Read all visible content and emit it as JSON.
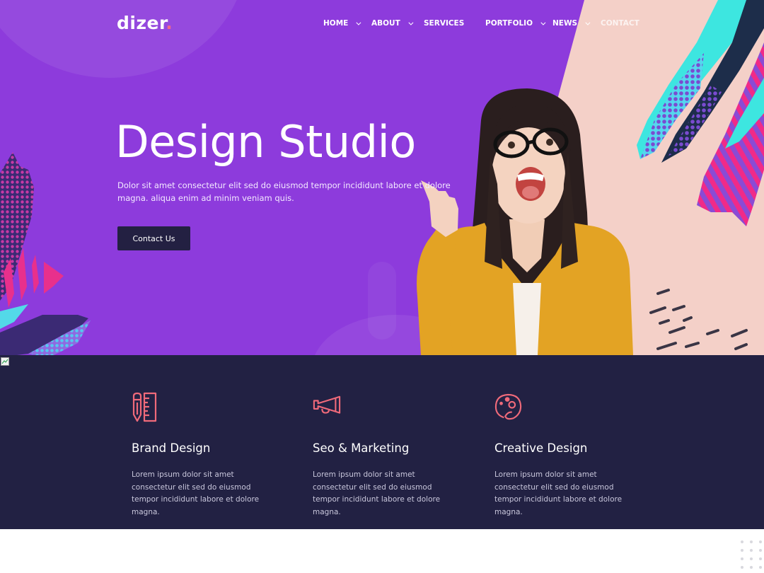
{
  "brand": {
    "name": "dizer",
    "dot": ".",
    "accent_color": "#f06a8a"
  },
  "nav": {
    "items": [
      {
        "label": "HOME",
        "has_dropdown": true
      },
      {
        "label": "ABOUT",
        "has_dropdown": true
      },
      {
        "label": "SERVICES",
        "has_dropdown": false
      },
      {
        "label": "PORTFOLIO",
        "has_dropdown": true
      },
      {
        "label": "NEWS",
        "has_dropdown": true
      },
      {
        "label": "CONTACT",
        "has_dropdown": false
      }
    ]
  },
  "hero": {
    "title": "Design Studio",
    "description": "Dolor sit amet consectetur elit sed do eiusmod tempor incididunt labore et dolore magna. aliqua enim ad minim veniam quis.",
    "cta_label": "Contact Us",
    "background_color": "#8d3bdc",
    "panel_color": "#f4d0c8",
    "image_alt": "Excited woman with glasses pointing up"
  },
  "features": {
    "background_color": "#222143",
    "icon_color": "#f06a7a",
    "items": [
      {
        "icon": "pencil-ruler-icon",
        "title": "Brand Design",
        "text": "Lorem ipsum dolor sit amet consectetur elit sed do eiusmod tempor incididunt labore et dolore magna."
      },
      {
        "icon": "megaphone-icon",
        "title": "Seo & Marketing",
        "text": "Lorem ipsum dolor sit amet consectetur elit sed do eiusmod tempor incididunt labore et dolore magna."
      },
      {
        "icon": "palette-icon",
        "title": "Creative Design",
        "text": "Lorem ipsum dolor sit amet consectetur elit sed do eiusmod tempor incididunt labore et dolore magna."
      }
    ]
  }
}
